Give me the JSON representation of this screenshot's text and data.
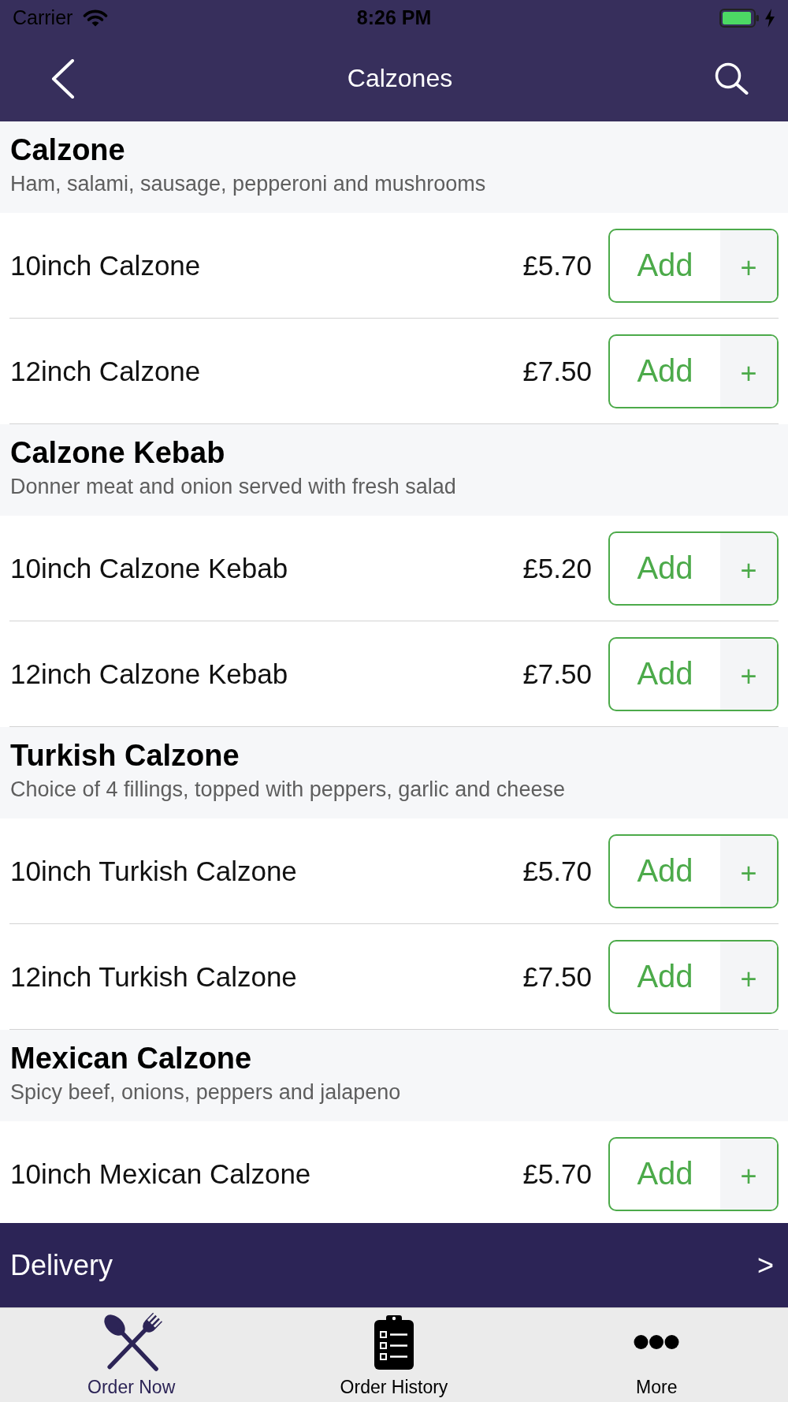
{
  "status_bar": {
    "carrier": "Carrier",
    "time": "8:26 PM"
  },
  "nav_bar": {
    "title": "Calzones"
  },
  "sections": [
    {
      "title": "Calzone",
      "description": "Ham, salami, sausage, pepperoni and mushrooms",
      "items": [
        {
          "name": "10inch Calzone",
          "price": "£5.70",
          "add_label": "Add",
          "add_symbol": "+"
        },
        {
          "name": "12inch Calzone",
          "price": "£7.50",
          "add_label": "Add",
          "add_symbol": "+"
        }
      ]
    },
    {
      "title": "Calzone Kebab",
      "description": "Donner meat and onion served with fresh salad",
      "items": [
        {
          "name": "10inch Calzone Kebab",
          "price": "£5.20",
          "add_label": "Add",
          "add_symbol": "+"
        },
        {
          "name": "12inch Calzone Kebab",
          "price": "£7.50",
          "add_label": "Add",
          "add_symbol": "+"
        }
      ]
    },
    {
      "title": "Turkish Calzone",
      "description": "Choice of 4 fillings, topped with peppers, garlic and cheese",
      "items": [
        {
          "name": "10inch Turkish Calzone",
          "price": "£5.70",
          "add_label": "Add",
          "add_symbol": "+"
        },
        {
          "name": "12inch Turkish Calzone",
          "price": "£7.50",
          "add_label": "Add",
          "add_symbol": "+"
        }
      ]
    },
    {
      "title": "Mexican Calzone",
      "description": "Spicy beef, onions, peppers and jalapeno",
      "items": [
        {
          "name": "10inch Mexican Calzone",
          "price": "£5.70",
          "add_label": "Add",
          "add_symbol": "+"
        }
      ]
    }
  ],
  "delivery_bar": {
    "label": "Delivery",
    "chevron": ">"
  },
  "tab_bar": [
    {
      "label": "Order Now",
      "selected": true
    },
    {
      "label": "Order History",
      "selected": false
    },
    {
      "label": "More",
      "selected": false
    }
  ]
}
